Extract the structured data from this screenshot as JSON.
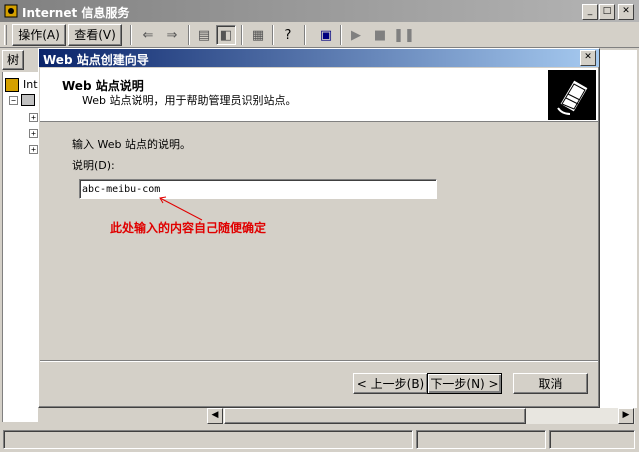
{
  "app": {
    "title": "Internet 信息服务"
  },
  "menu": {
    "items": [
      "操作(A)",
      "查看(V)"
    ]
  },
  "tree": {
    "tab_label": "树",
    "root_label": "Inte"
  },
  "dialog": {
    "title": "Web 站点创建向导",
    "header_title": "Web 站点说明",
    "header_subtitle": "Web 站点说明，用于帮助管理员识别站点。",
    "instruction": "输入 Web 站点的说明。",
    "field_label": "说明(D):",
    "field_value": "abc-meibu-com",
    "annotation": "此处输入的内容自己随便确定",
    "buttons": {
      "back": "< 上一步(B)",
      "next": "下一步(N) >",
      "cancel": "取消"
    }
  },
  "colors": {
    "dialog_title": "#0a246a",
    "annotation": "#e00000",
    "window_bg": "#d4d0c8"
  },
  "icons": {
    "app": "iis-icon",
    "wizard": "book-icon"
  }
}
